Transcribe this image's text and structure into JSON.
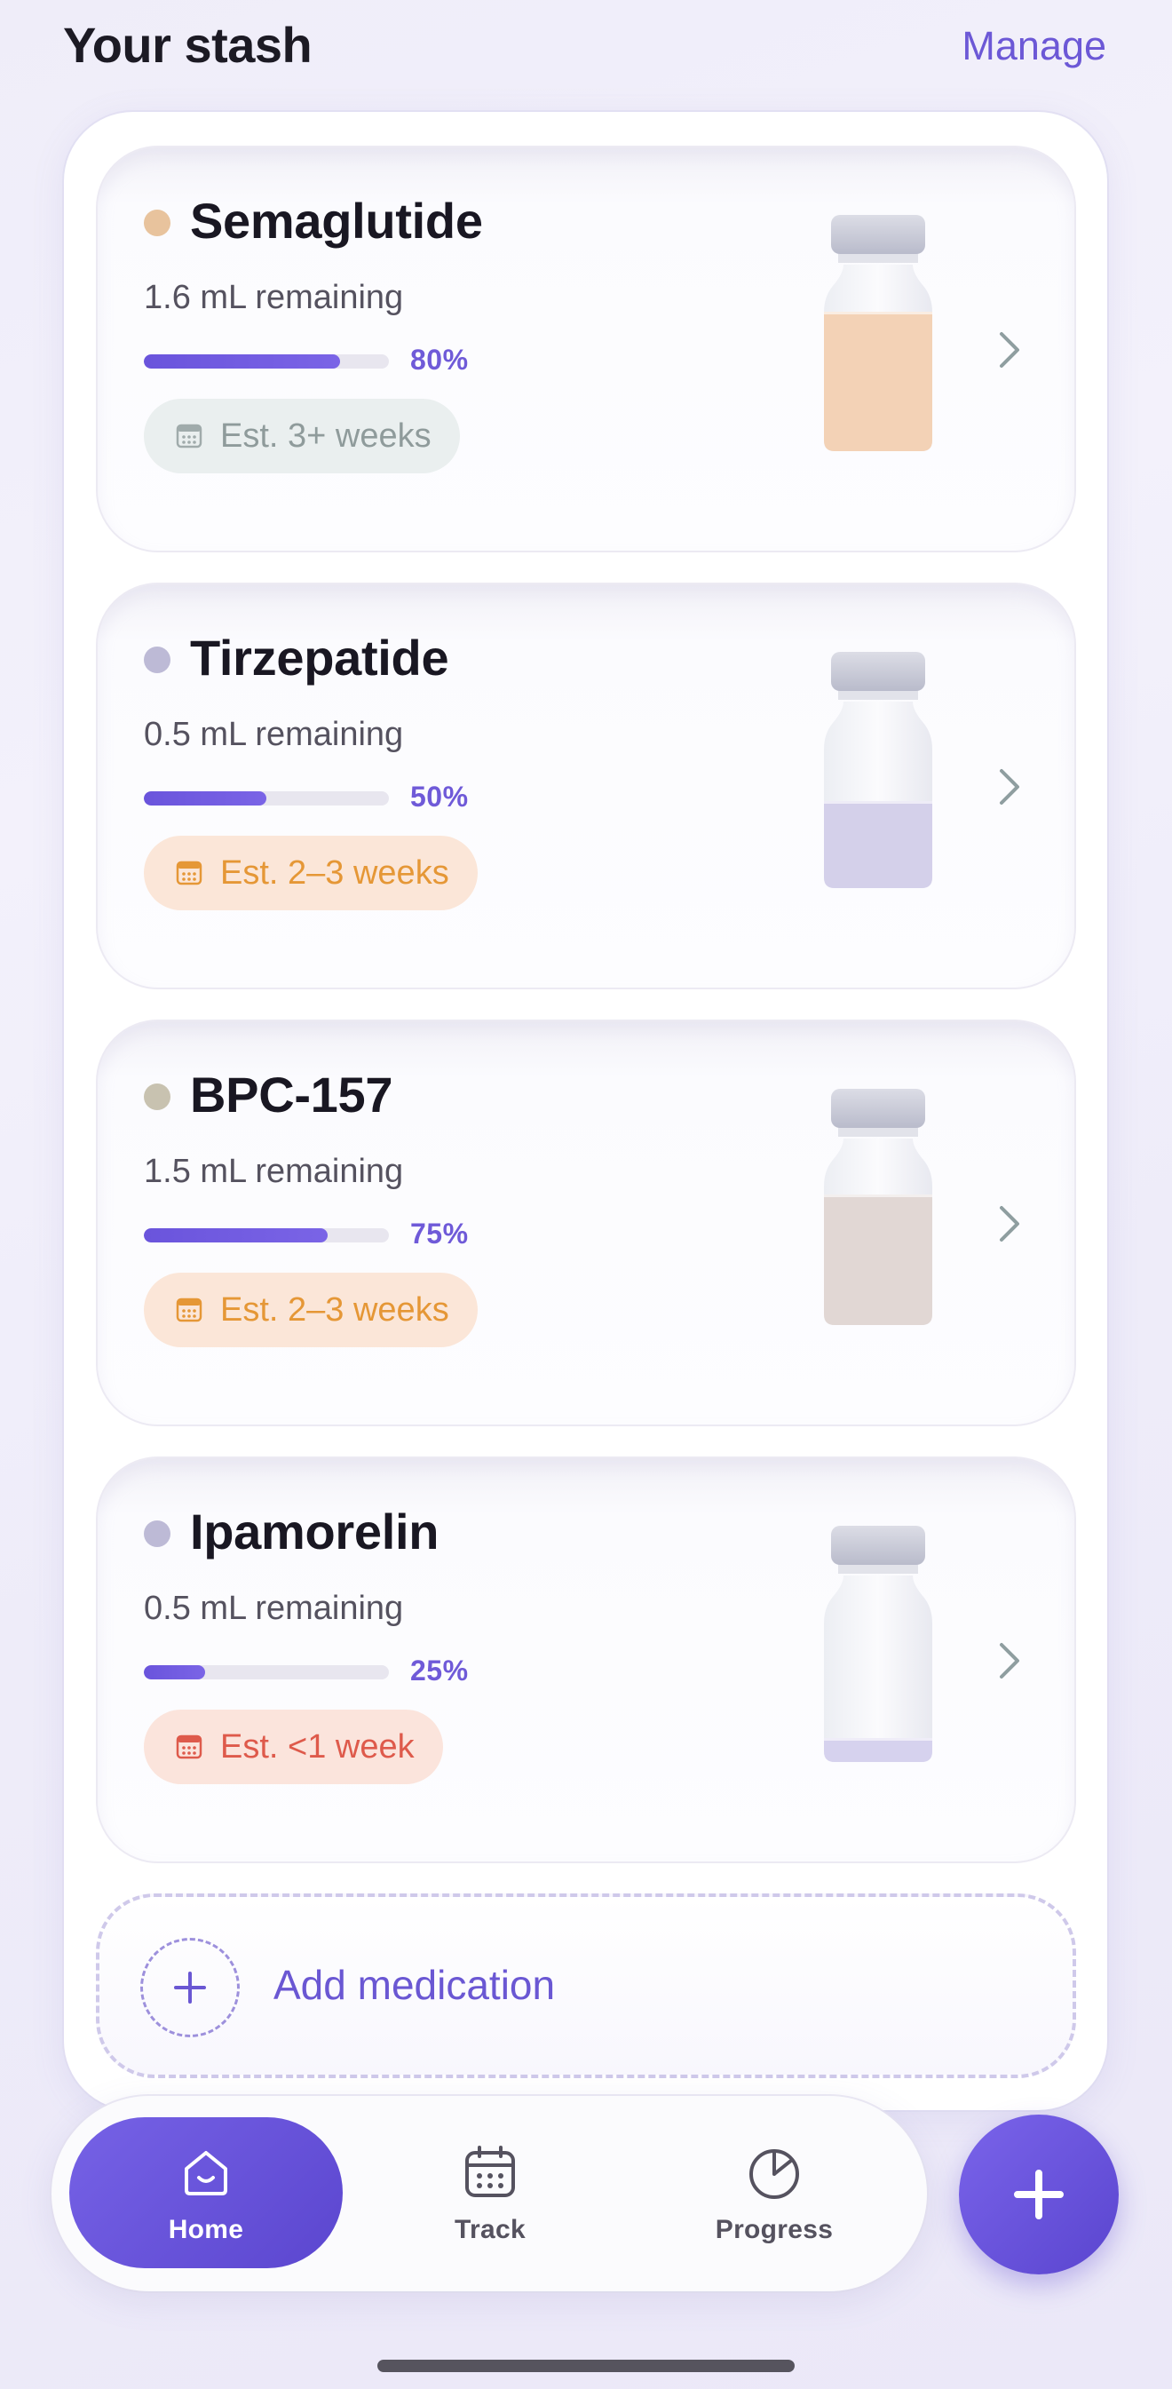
{
  "header": {
    "title": "Your stash",
    "manage_label": "Manage"
  },
  "medications": [
    {
      "name": "Semaglutide",
      "dot_color": "#e8c39d",
      "remaining": "1.6 mL remaining",
      "percent_label": "80%",
      "percent": 80,
      "estimate": "Est. 3+ weeks",
      "estimate_style": "gray",
      "fluid_color": "#f3d2b6",
      "fill_level": 0.8
    },
    {
      "name": "Tirzepatide",
      "dot_color": "#bdbad6",
      "remaining": "0.5 mL remaining",
      "percent_label": "50%",
      "percent": 50,
      "estimate": "Est. 2–3 weeks",
      "estimate_style": "orange",
      "fluid_color": "#d4d0ea",
      "fill_level": 0.5
    },
    {
      "name": "BPC-157",
      "dot_color": "#c8c2b0",
      "remaining": "1.5 mL remaining",
      "percent_label": "75%",
      "percent": 75,
      "estimate": "Est. 2–3 weeks",
      "estimate_style": "orange",
      "fluid_color": "#e1d7d4",
      "fill_level": 0.75
    },
    {
      "name": "Ipamorelin",
      "dot_color": "#bdbad6",
      "remaining": "0.5 mL remaining",
      "percent_label": "25%",
      "percent": 25,
      "estimate": "Est. <1 week",
      "estimate_style": "red",
      "fluid_color": "#d6d2ee",
      "fill_level": 0.14
    }
  ],
  "add_medication_label": "Add medication",
  "tabbar": {
    "tabs": [
      {
        "label": "Home",
        "icon": "home-icon",
        "active": true
      },
      {
        "label": "Track",
        "icon": "calendar-icon",
        "active": false
      },
      {
        "label": "Progress",
        "icon": "pie-chart-icon",
        "active": false
      }
    ]
  },
  "fab_icon": "plus-icon",
  "colors": {
    "accent": "#6a57d3",
    "accent_dark": "#5b46cf",
    "progress_fill": "#6a54dc"
  }
}
